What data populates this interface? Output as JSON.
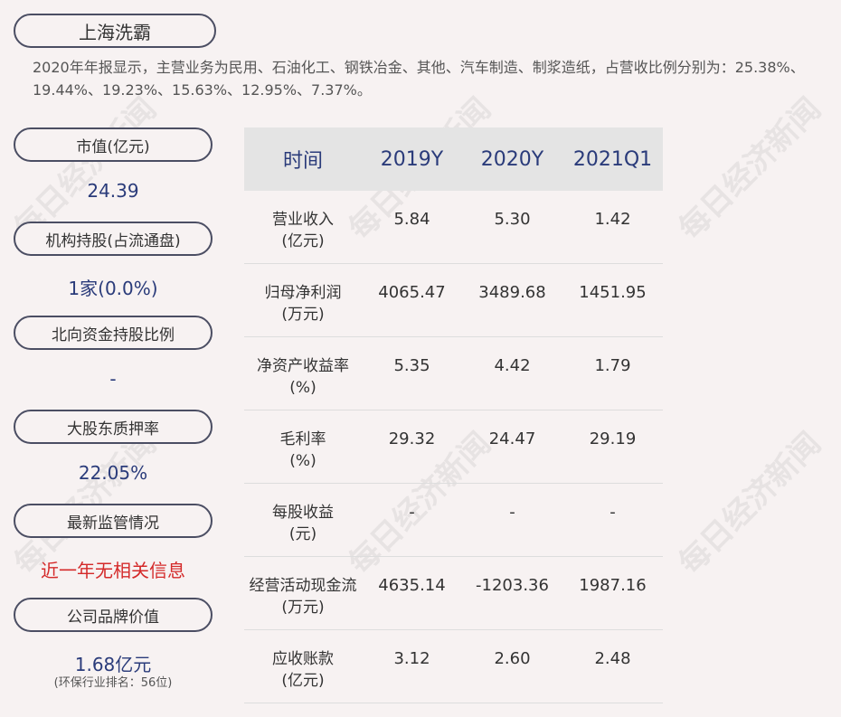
{
  "company": "上海洗霸",
  "summary": "2020年年报显示，主营业务为民用、石油化工、钢铁冶金、其他、汽车制造、制浆造纸，占营收比例分别为：25.38%、19.44%、19.23%、15.63%、12.95%、7.37%。",
  "side": [
    {
      "label": "市值(亿元)",
      "value": "24.39"
    },
    {
      "label": "机构持股(占流通盘)",
      "value": "1家(0.0%)"
    },
    {
      "label": "北向资金持股比例",
      "value": "-"
    },
    {
      "label": "大股东质押率",
      "value": "22.05%"
    },
    {
      "label": "最新监管情况",
      "value": "近一年无相关信息"
    },
    {
      "label": "公司品牌价值",
      "value": "1.68亿元",
      "sub": "(环保行业排名：56位)"
    }
  ],
  "table": {
    "headers": [
      "时间",
      "2019Y",
      "2020Y",
      "2021Q1"
    ],
    "rows": [
      {
        "l1": "营业收入",
        "l2": "(亿元)",
        "v": [
          "5.84",
          "5.30",
          "1.42"
        ]
      },
      {
        "l1": "归母净利润",
        "l2": "(万元)",
        "v": [
          "4065.47",
          "3489.68",
          "1451.95"
        ]
      },
      {
        "l1": "净资产收益率",
        "l2": "(%)",
        "v": [
          "5.35",
          "4.42",
          "1.79"
        ]
      },
      {
        "l1": "毛利率",
        "l2": "(%)",
        "v": [
          "29.32",
          "24.47",
          "29.19"
        ]
      },
      {
        "l1": "每股收益",
        "l2": "(元)",
        "v": [
          "-",
          "-",
          "-"
        ]
      },
      {
        "l1": "经营活动现金流",
        "l2": "(万元)",
        "v": [
          "4635.14",
          "-1203.36",
          "1987.16"
        ]
      },
      {
        "l1": "应收账款",
        "l2": "(亿元)",
        "v": [
          "3.12",
          "2.60",
          "2.48"
        ]
      }
    ]
  },
  "watermark": "每日经济新闻"
}
